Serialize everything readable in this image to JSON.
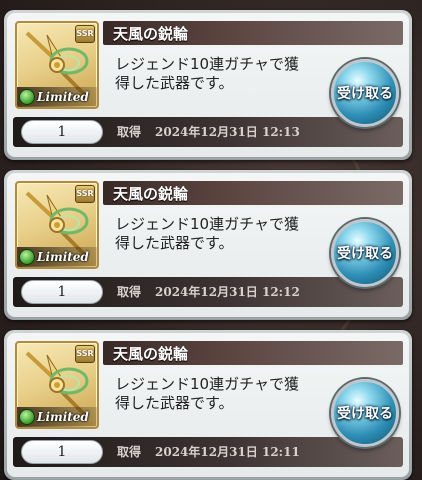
{
  "items": [
    {
      "name": "天風の鋭輪",
      "rarity": "SSR",
      "tag": "Limited",
      "description_line1": "レジェンド10連ガチャで獲",
      "description_line2": "得した武器です。",
      "quantity": "1",
      "acquired_label": "取得",
      "acquired_date": "2024年12月31日 12:13",
      "receive_label": "受け取る"
    },
    {
      "name": "天風の鋭輪",
      "rarity": "SSR",
      "tag": "Limited",
      "description_line1": "レジェンド10連ガチャで獲",
      "description_line2": "得した武器です。",
      "quantity": "1",
      "acquired_label": "取得",
      "acquired_date": "2024年12月31日 12:12",
      "receive_label": "受け取る"
    },
    {
      "name": "天風の鋭輪",
      "rarity": "SSR",
      "tag": "Limited",
      "description_line1": "レジェンド10連ガチャで獲",
      "description_line2": "得した武器です。",
      "quantity": "1",
      "acquired_label": "取得",
      "acquired_date": "2024年12月31日 12:11",
      "receive_label": "受け取る"
    }
  ],
  "colors": {
    "button_blue": "#2f8fb6",
    "card_bg": "#eef1f1",
    "title_bar": "#3a2a26",
    "limited_green": "#3a9a2a"
  },
  "icons": {
    "weapon": "wind-ring-weapon-icon",
    "element": "wind-element-icon"
  }
}
